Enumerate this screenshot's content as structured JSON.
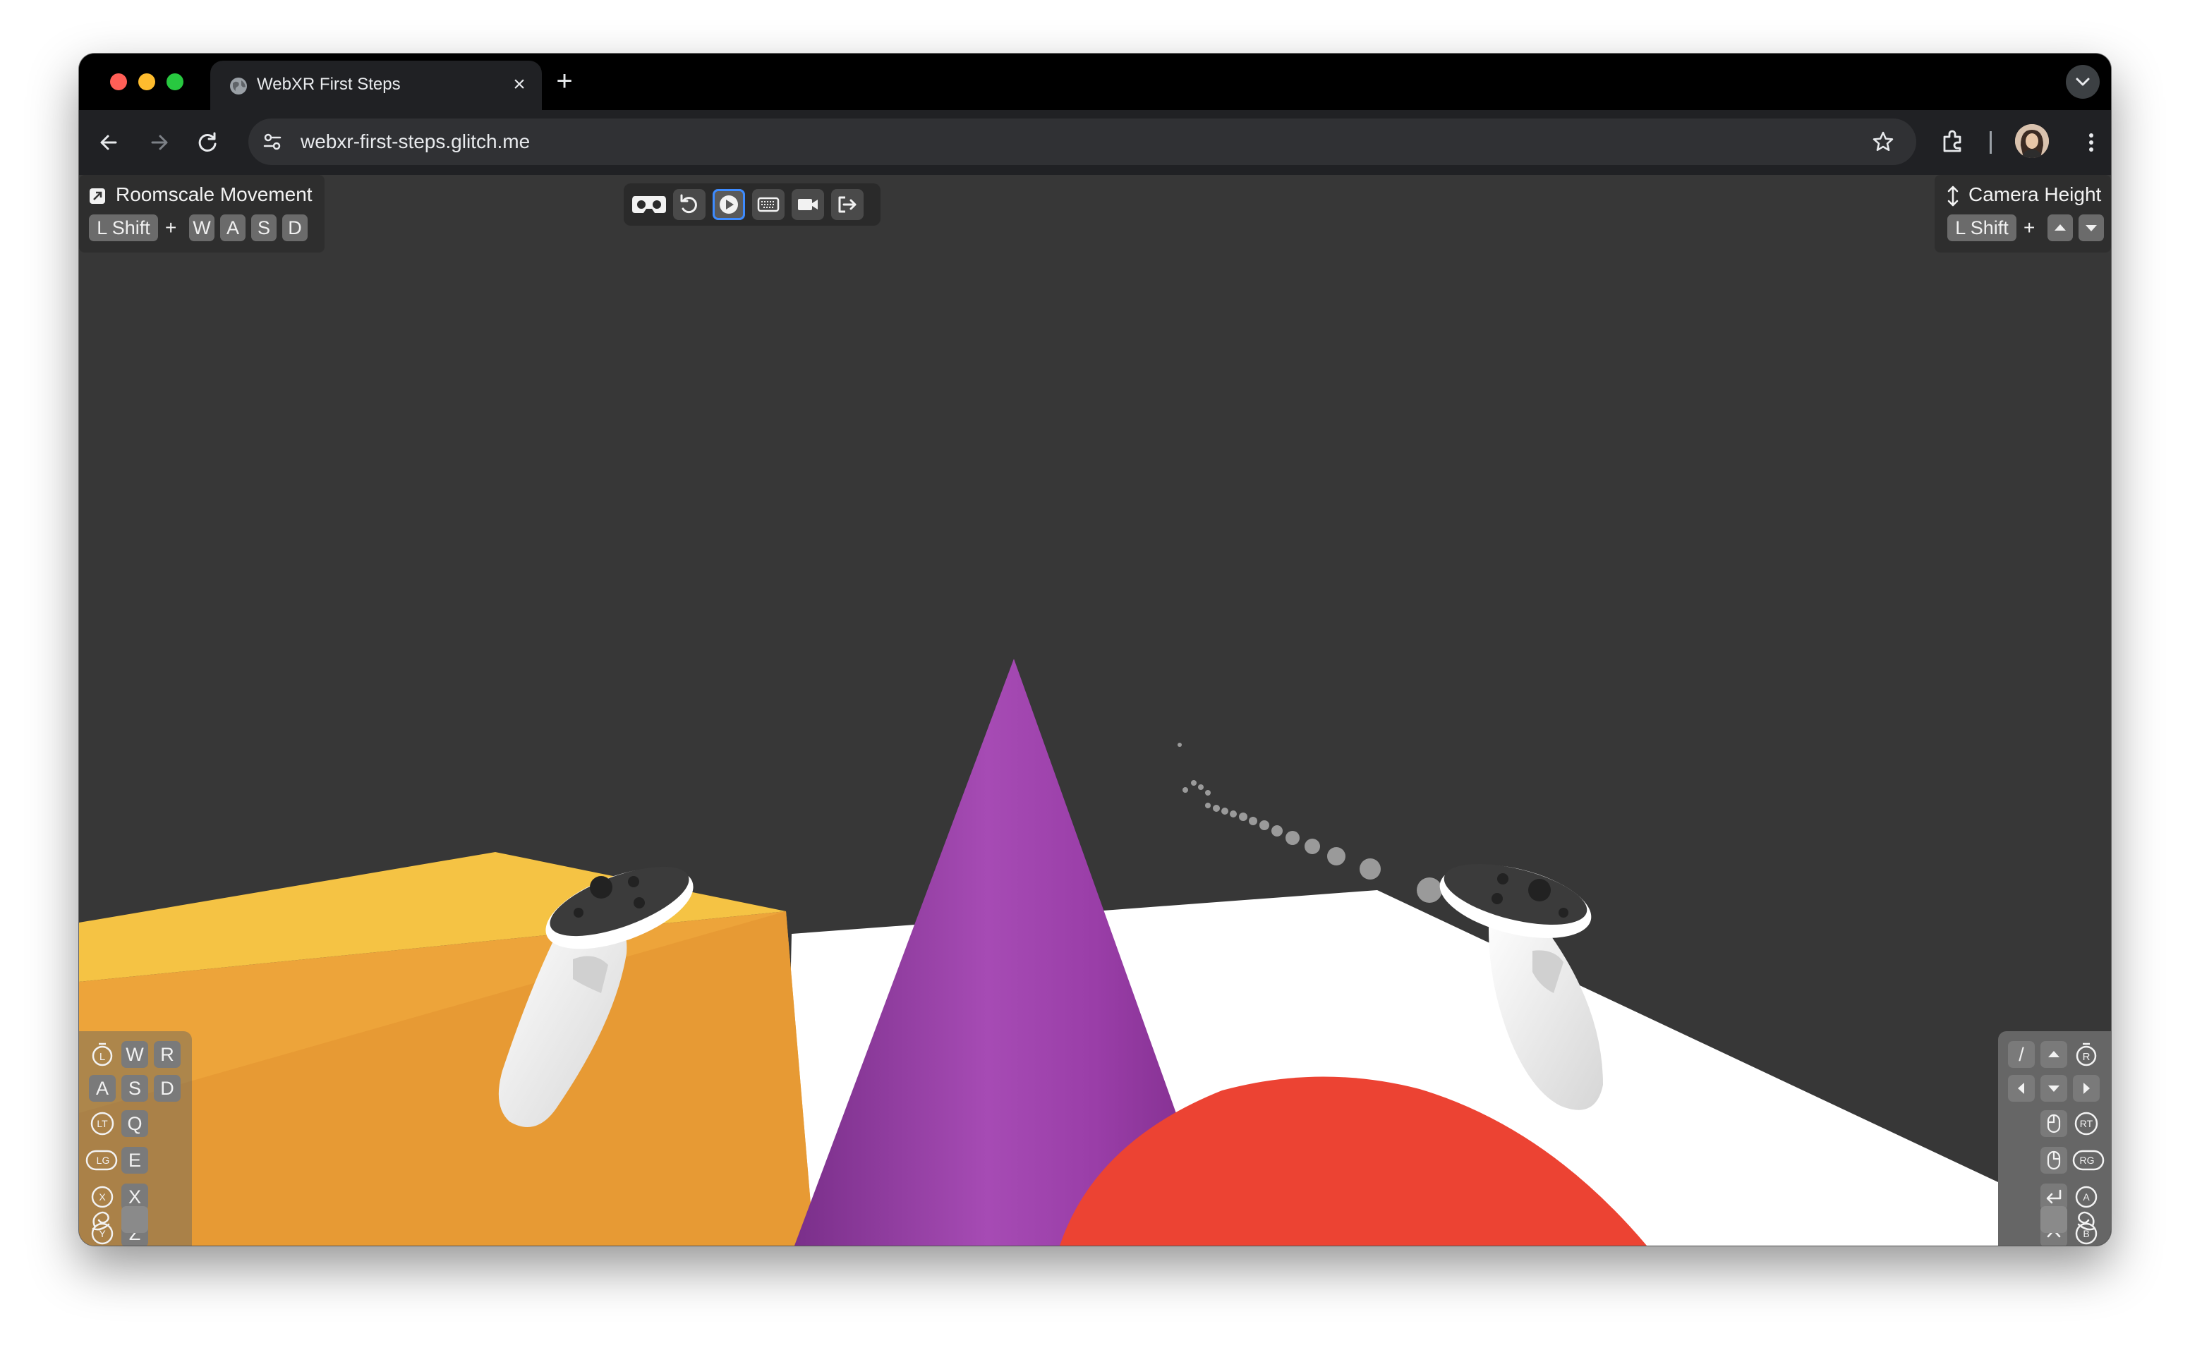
{
  "browser": {
    "tab": {
      "title": "WebXR First Steps"
    },
    "address": {
      "url": "webxr-first-steps.glitch.me"
    }
  },
  "hud": {
    "roomscale": {
      "title": "Roomscale Movement",
      "modifier": "L Shift",
      "plus": "+",
      "keys": [
        "W",
        "A",
        "S",
        "D"
      ]
    },
    "camera_height": {
      "title": "Camera Height",
      "modifier": "L Shift",
      "plus": "+"
    },
    "controls": [
      "headset-icon",
      "reset-icon",
      "play-icon",
      "keyboard-icon",
      "video-camera-icon",
      "exit-icon"
    ],
    "left_controller_keys": {
      "row1": [
        "W",
        "R"
      ],
      "row2": [
        "A",
        "S",
        "D"
      ],
      "row3": [
        "Q"
      ],
      "row4": [
        "E"
      ],
      "row5": [
        "X"
      ],
      "row6": [
        "Z"
      ],
      "icon_labels": [
        "L",
        "LT",
        "LG",
        "X",
        "Y"
      ]
    },
    "right_controller_keys": {
      "row1": [
        "/"
      ],
      "icon_labels": [
        "R",
        "RT",
        "RG",
        "A",
        "B"
      ]
    }
  },
  "colors": {
    "background": "#373737",
    "yellow_box": "#f5c344",
    "orange_box": "#eda43a",
    "cone": "#9b3fa8",
    "sphere": "#ec4333",
    "floor": "#ffffff",
    "accent": "#3d8bff"
  }
}
